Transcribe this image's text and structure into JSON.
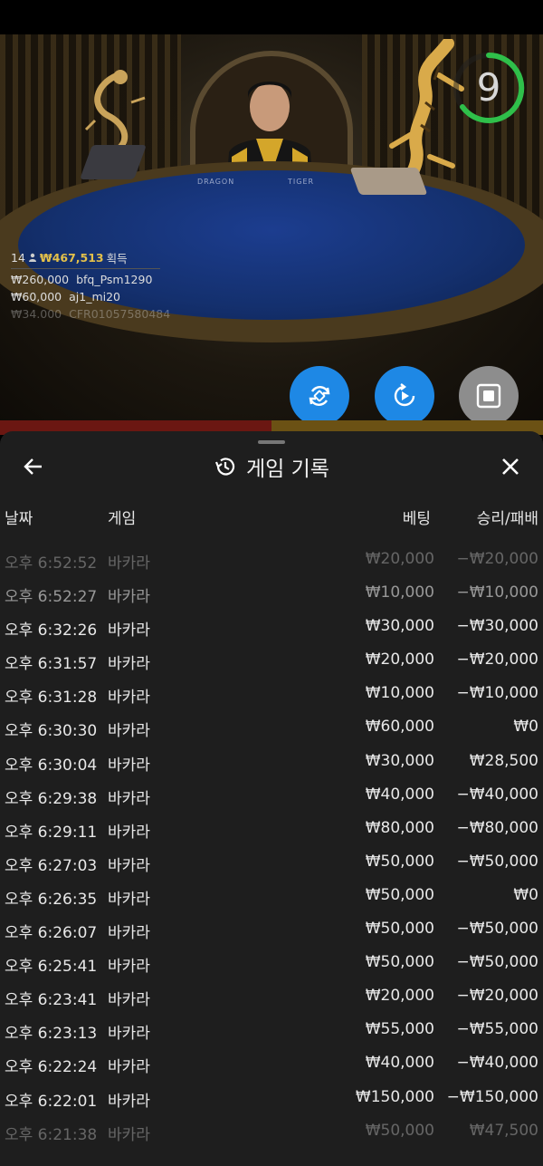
{
  "video": {
    "timer": "9",
    "table_left_text": "DRAGON",
    "table_right_text": "TIGER",
    "winners": {
      "count": "14",
      "total": "₩467,513",
      "total_label": "획득",
      "rows": [
        {
          "amount": "₩260,000",
          "user": "bfq_Psm1290"
        },
        {
          "amount": "₩60,000",
          "user": "aj1_mi20"
        },
        {
          "amount": "₩34,000",
          "user": "CFR01057580484"
        }
      ]
    }
  },
  "controls": {
    "left_icon": "rotate-refresh-icon",
    "middle_icon": "replay-video-icon",
    "right_icon": "stop-icon",
    "blue": "#1e88e5",
    "gray": "#8d8d8d"
  },
  "history": {
    "title": "게임 기록",
    "back_icon": "arrow-left-icon",
    "close_icon": "close-icon",
    "title_icon": "history-icon",
    "columns": {
      "date": "날짜",
      "game": "게임",
      "bet": "베팅",
      "result": "승리/패배"
    },
    "rows": [
      {
        "time": "오후 6:52:52",
        "game": "바카라",
        "bet": "₩20,000",
        "result": "−₩20,000"
      },
      {
        "time": "오후 6:52:27",
        "game": "바카라",
        "bet": "₩10,000",
        "result": "−₩10,000"
      },
      {
        "time": "오후 6:32:26",
        "game": "바카라",
        "bet": "₩30,000",
        "result": "−₩30,000"
      },
      {
        "time": "오후 6:31:57",
        "game": "바카라",
        "bet": "₩20,000",
        "result": "−₩20,000"
      },
      {
        "time": "오후 6:31:28",
        "game": "바카라",
        "bet": "₩10,000",
        "result": "−₩10,000"
      },
      {
        "time": "오후 6:30:30",
        "game": "바카라",
        "bet": "₩60,000",
        "result": "₩0"
      },
      {
        "time": "오후 6:30:04",
        "game": "바카라",
        "bet": "₩30,000",
        "result": "₩28,500"
      },
      {
        "time": "오후 6:29:38",
        "game": "바카라",
        "bet": "₩40,000",
        "result": "−₩40,000"
      },
      {
        "time": "오후 6:29:11",
        "game": "바카라",
        "bet": "₩80,000",
        "result": "−₩80,000"
      },
      {
        "time": "오후 6:27:03",
        "game": "바카라",
        "bet": "₩50,000",
        "result": "−₩50,000"
      },
      {
        "time": "오후 6:26:35",
        "game": "바카라",
        "bet": "₩50,000",
        "result": "₩0"
      },
      {
        "time": "오후 6:26:07",
        "game": "바카라",
        "bet": "₩50,000",
        "result": "−₩50,000"
      },
      {
        "time": "오후 6:25:41",
        "game": "바카라",
        "bet": "₩50,000",
        "result": "−₩50,000"
      },
      {
        "time": "오후 6:23:41",
        "game": "바카라",
        "bet": "₩20,000",
        "result": "−₩20,000"
      },
      {
        "time": "오후 6:23:13",
        "game": "바카라",
        "bet": "₩55,000",
        "result": "−₩55,000"
      },
      {
        "time": "오후 6:22:24",
        "game": "바카라",
        "bet": "₩40,000",
        "result": "−₩40,000"
      },
      {
        "time": "오후 6:22:01",
        "game": "바카라",
        "bet": "₩150,000",
        "result": "−₩150,000"
      },
      {
        "time": "오후 6:21:38",
        "game": "바카라",
        "bet": "₩50,000",
        "result": "₩47,500"
      }
    ]
  }
}
